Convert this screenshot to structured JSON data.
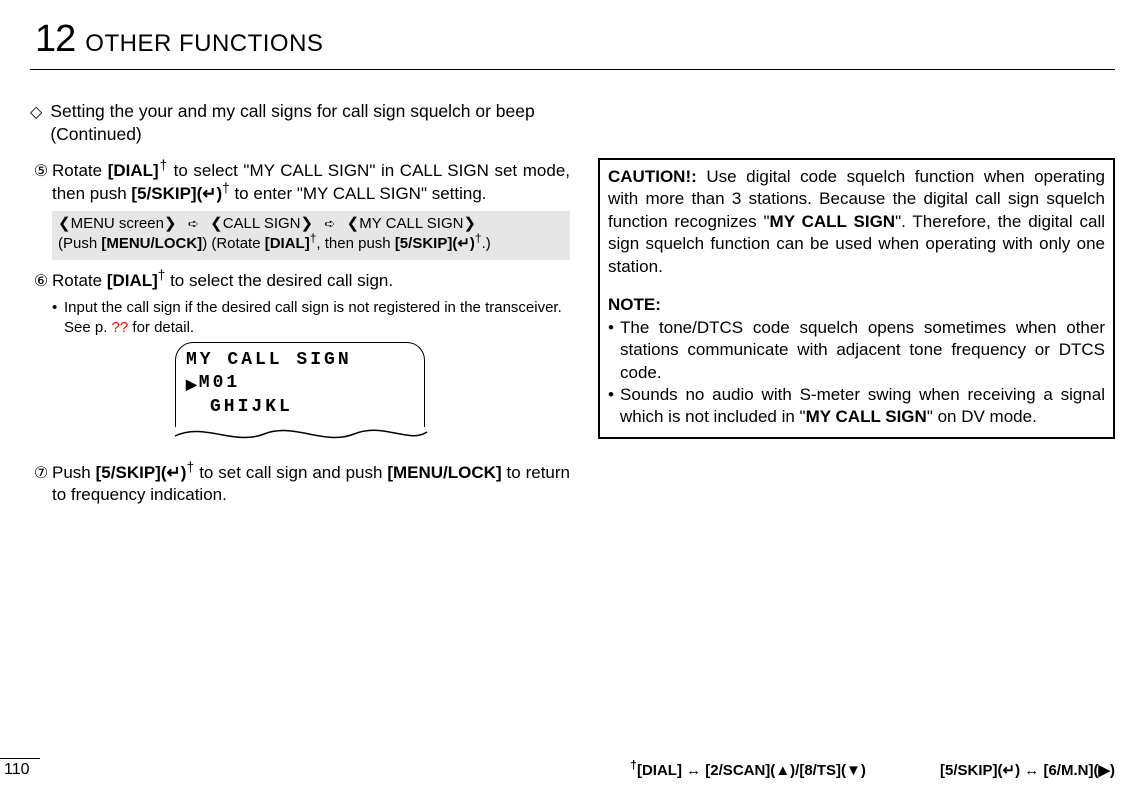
{
  "chapter": {
    "number": "12",
    "title": "OTHER FUNCTIONS"
  },
  "section": {
    "diamond": "◇",
    "title": "Setting the your and my call signs for call sign squelch or beep (Continued)"
  },
  "steps": {
    "s5": {
      "num": "⑤",
      "t1": "Rotate ",
      "b1": "[DIAL]",
      "dag1": "†",
      "t2": " to select \"MY CALL SIGN\" in CALL SIGN set mode, then push ",
      "b2": "[5/SKIP](",
      "enter1": "↵",
      "b2b": ")",
      "dag2": "†",
      "t3": " to enter \"MY CALL SIGN\" setting."
    },
    "s6": {
      "num": "⑥",
      "t1": "Rotate ",
      "b1": "[DIAL]",
      "dag1": "†",
      "t2": " to select the desired call sign.",
      "bullet": "•",
      "note_a": "Input the call sign if the desired call sign is not registered in the transceiver. See p. ",
      "note_q": "??",
      "note_b": " for detail."
    },
    "s7": {
      "num": "⑦",
      "t1": "Push  ",
      "b1": "[5/SKIP](",
      "enter1": "↵",
      "b1b": ")",
      "dag1": "†",
      "t2": "  to  set  call  sign  and  push ",
      "b2": "[MENU/LOCK]",
      "t3": " to return to frequency indication."
    }
  },
  "menu_path": {
    "lbr": "❮",
    "rbr": "❯",
    "arr": "➪",
    "item1": "MENU screen",
    "item2": "CALL SIGN",
    "item3": "MY CALL SIGN",
    "line2_a": "(Push ",
    "line2_b": "[MENU/LOCK]",
    "line2_c": ")  (Rotate ",
    "line2_d": "[DIAL]",
    "line2_dag1": "†",
    "line2_e": ", then push ",
    "line2_f": "[5/SKIP](",
    "line2_enter": "↵",
    "line2_g": ")",
    "line2_dag2": "†",
    "line2_h": ".)"
  },
  "lcd": {
    "line1": "MY CALL SIGN",
    "pointer": "▶",
    "line2": "M01",
    "line3": "GHIJKL"
  },
  "caution": {
    "head": "CAUTION!:",
    "p1a": " Use digital code squelch function when operating with more than 3 stations. Because the digital call sign squelch function recognizes \"",
    "p1b": "MY CALL SIGN",
    "p1c": "\". Therefore, the digital call sign squelch function can be used when operating with only one station.",
    "note": "NOTE:",
    "bul": "•",
    "n1": "The tone/DTCS code squelch opens sometimes when other stations communicate with adjacent tone frequency or DTCS code.",
    "n2a": "Sounds no audio with S-meter swing when receiving a signal which is not included in \"",
    "n2b": "MY CALL SIGN",
    "n2c": "\" on DV mode."
  },
  "footer": {
    "page": "110",
    "dag": "†",
    "seg1a": "[DIAL] ↔ [2/SCAN](",
    "up": "▲",
    "seg1b": ")/[8/TS](",
    "down": "▼",
    "seg1c": ")",
    "seg2a": "[5/SKIP](",
    "enter": "↵",
    "seg2b": ") ↔ [6/M.N](",
    "right": "▶",
    "seg2c": ")"
  }
}
